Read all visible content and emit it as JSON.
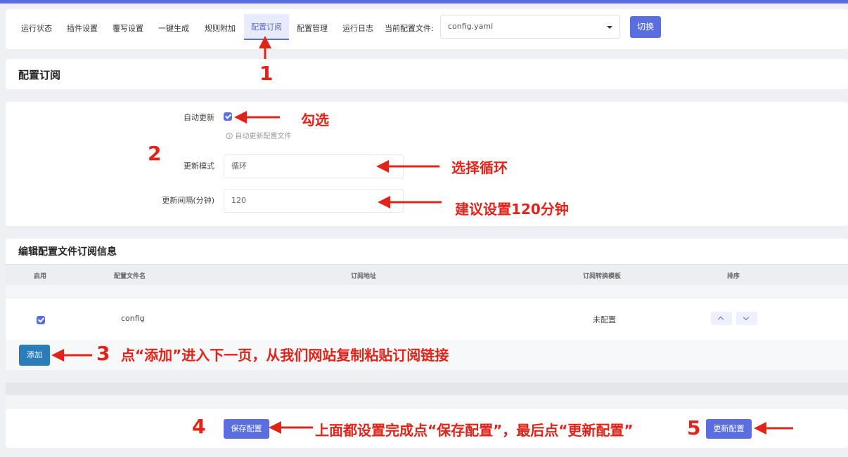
{
  "tabs": [
    {
      "label": "运行状态"
    },
    {
      "label": "插件设置"
    },
    {
      "label": "覆写设置"
    },
    {
      "label": "一键生成"
    },
    {
      "label": "规则附加"
    },
    {
      "label": "配置订阅"
    },
    {
      "label": "配置管理"
    },
    {
      "label": "运行日志"
    }
  ],
  "active_tab": "配置订阅",
  "config_file": {
    "label": "当前配置文件:",
    "value": "config.yaml"
  },
  "switch_label": "切换",
  "section_title": "配置订阅",
  "form": {
    "auto_update": {
      "label": "自动更新",
      "checked": true,
      "hint": "自动更新配置文件"
    },
    "update_mode": {
      "label": "更新模式",
      "value": "循环"
    },
    "update_interval": {
      "label": "更新间隔(分钟)",
      "value": "120"
    }
  },
  "table": {
    "title": "编辑配置文件订阅信息",
    "headers": [
      "启用",
      "配置文件名",
      "订阅地址",
      "订阅转换模板",
      "排序"
    ],
    "rows": [
      {
        "enabled": true,
        "name": "config",
        "url": "",
        "template": "未配置"
      }
    ],
    "add_label": "添加"
  },
  "save_label": "保存配置",
  "update_label": "更新配置",
  "annotations": {
    "n1": "1",
    "n2": "2",
    "n3": "3",
    "n4": "4",
    "n5": "5",
    "check": "勾选",
    "select_loop": "选择循环",
    "interval_tip": "建议设置120分钟",
    "add_tip": "点“添加”进入下一页，从我们网站复制粘贴订阅链接",
    "save_tip": "上面都设置完成点“保存配置”，最后点“更新配置”"
  },
  "colors": {
    "accent": "#5a6ee0",
    "annotation": "#e2231a",
    "add_button": "#2a7db8"
  }
}
